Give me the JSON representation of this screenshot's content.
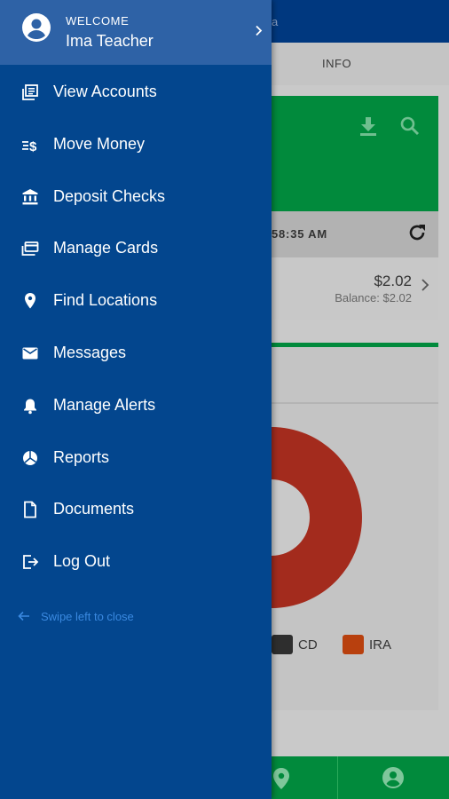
{
  "background": {
    "tab_info": "INFO",
    "header_hint": "a",
    "status_time": "58:35 AM",
    "account": {
      "amount": "$2.02",
      "balance": "Balance: $2.02"
    },
    "legend": [
      {
        "label": "CD",
        "color": "#2e2e2e"
      },
      {
        "label": "IRA",
        "color": "#b8400e"
      }
    ],
    "colors": {
      "primary": "#00387f",
      "green": "#018a3c",
      "pie": "#a32b1d"
    }
  },
  "drawer": {
    "welcome_label": "WELCOME",
    "user_name": "Ima Teacher",
    "items": [
      {
        "label": "View Accounts",
        "icon": "accounts-icon"
      },
      {
        "label": "Move Money",
        "icon": "transfer-icon"
      },
      {
        "label": "Deposit Checks",
        "icon": "bank-icon"
      },
      {
        "label": "Manage Cards",
        "icon": "cards-icon"
      },
      {
        "label": "Find Locations",
        "icon": "location-pin-icon"
      },
      {
        "label": "Messages",
        "icon": "mail-icon"
      },
      {
        "label": "Manage Alerts",
        "icon": "bell-icon"
      },
      {
        "label": "Reports",
        "icon": "pie-chart-icon"
      },
      {
        "label": "Documents",
        "icon": "document-icon"
      },
      {
        "label": "Log Out",
        "icon": "logout-icon"
      }
    ],
    "swipe_hint": "Swipe left to close",
    "colors": {
      "drawer_bg": "#03468e",
      "header_bg": "#2e62a6",
      "hint": "#3a89e0"
    }
  }
}
